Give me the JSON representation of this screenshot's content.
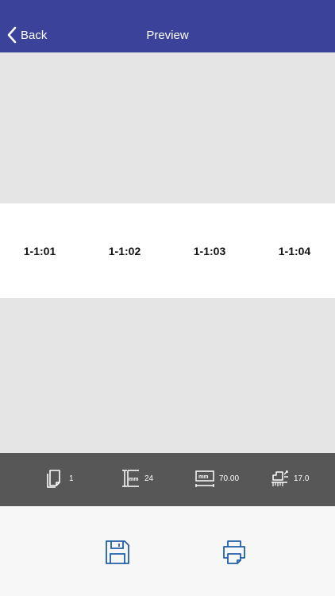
{
  "header": {
    "back_label": "Back",
    "title": "Preview"
  },
  "labels": [
    "1-1:01",
    "1-1:02",
    "1-1:03",
    "1-1:04"
  ],
  "info": {
    "copies": "1",
    "tape_width": "24",
    "label_length": "70.00",
    "margin": "17.0",
    "icons": [
      "copies-icon",
      "tape-width-icon",
      "label-length-icon",
      "margin-icon"
    ]
  },
  "actions": {
    "icons": [
      "save-icon",
      "print-icon"
    ]
  },
  "colors": {
    "navbar": "#3a429a",
    "info_bar": "#575757",
    "action_icon": "#1f5fa8"
  }
}
